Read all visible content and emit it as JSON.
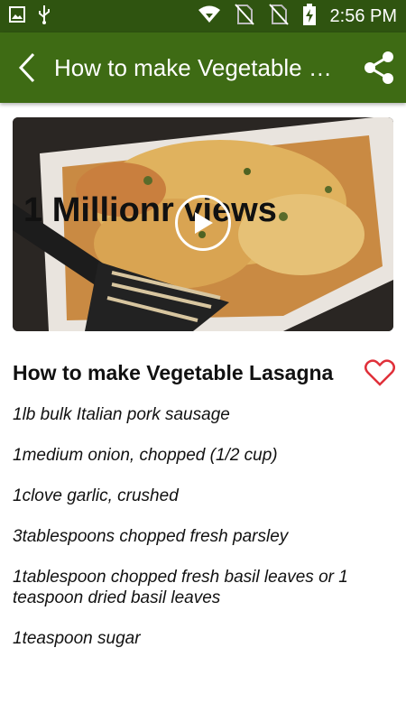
{
  "status_bar": {
    "time": "2:56 PM",
    "icons": [
      "image-icon",
      "usb-icon",
      "wifi-icon",
      "no-sim-icon",
      "no-sim-icon",
      "battery-charging-icon"
    ]
  },
  "app_bar": {
    "title": "How to make Vegetable Lasagna",
    "back_icon": "arrow-back-icon",
    "share_icon": "share-icon",
    "color": "#3e6b14"
  },
  "video": {
    "overlay_text": "1 Millionr views",
    "play_icon": "play-icon"
  },
  "recipe": {
    "title": "How to make Vegetable Lasagna",
    "favorite_icon": "heart-outline-icon",
    "ingredients": [
      "1lb bulk Italian pork sausage",
      "1medium onion, chopped (1/2 cup)",
      "1clove garlic, crushed",
      "3tablespoons chopped fresh parsley",
      "1tablespoon chopped fresh basil leaves or 1 teaspoon dried basil leaves",
      "1teaspoon sugar"
    ]
  }
}
